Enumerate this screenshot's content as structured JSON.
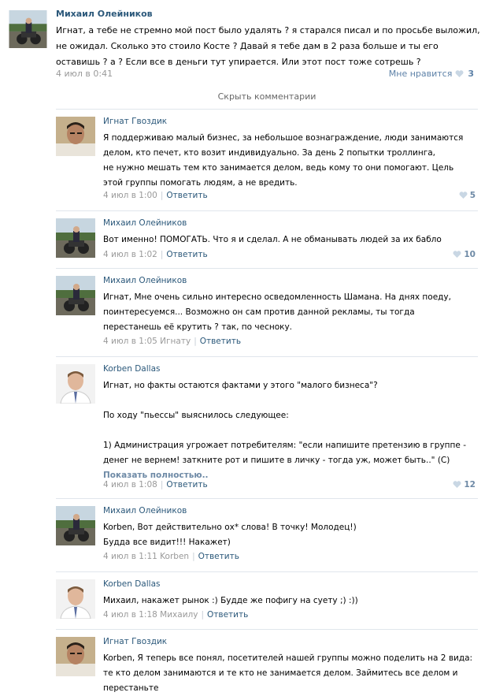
{
  "post": {
    "author": "Михаил Олейников",
    "text": "Игнат, а тебе не стремно мой пост было удалять ? я старался писал и по просьбе выложил, не ожидал. Сколько это стоило Косте ? Давай я тебе дам в 2 раза больше и ты его оставишь ? а ? Если все в деньги тут упирается. Или этот пост тоже сотрешь ?",
    "date": "4 июл в 0:41",
    "like_label": "Мне нравится",
    "like_count": "3"
  },
  "hide_comments": "Скрыть комментарии",
  "comments": [
    {
      "author": "Игнат Гвоздик",
      "text": "Я поддерживаю малый бизнес, за небольшое вознаграждение, люди занимаются делом, кто печет, кто возит индивидуально. За день 2 попытки троллинга,\nне нужно мешать тем кто занимается делом, ведь кому то они помогают. Цель этой группы помогать людям, а не вредить.",
      "date": "4 июл в 1:00",
      "reply": "Ответить",
      "likes": "5"
    },
    {
      "author": "Михаил Олейников",
      "text": "Вот именно! ПОМОГАТЬ. Что я и сделал. А не обманывать людей за их бабло",
      "date": "4 июл в 1:02",
      "reply": "Ответить",
      "likes": "10"
    },
    {
      "author": "Михаил Олейников",
      "text": "Игнат, Мне очень сильно интересно осведомленность Шамана. На днях поеду, поинтересуемся... Возможно он сам против данной рекламы, ты тогда перестанешь её крутить ? так, по чесноку.",
      "date": "4 июл в 1:05 Игнату",
      "reply": "Ответить",
      "likes": ""
    },
    {
      "author": "Korben Dallas",
      "text": "Игнат, но факты остаются фактами у этого \"малого бизнеса\"?\n\nПо ходу \"пьессы\" выяснилось следующее:\n\n1) Администрация угрожает потребителям: \"если напишите претензию в группе - денег не вернем! заткните рот и пишите в личку - тогда уж, может быть..\" (С)",
      "show_more": "Показать полностью..",
      "date": "4 июл в 1:08",
      "reply": "Ответить",
      "likes": "12"
    },
    {
      "author": "Михаил Олейников",
      "text": "Korben, Вот действительно ох* слова! В точку! Молодец!)\nБудда все видит!!! Накажет)",
      "date": "4 июл в 1:11 Korben",
      "reply": "Ответить",
      "likes": ""
    },
    {
      "author": "Korben Dallas",
      "text": "Михаил, накажет рынок :) Будде же пофигу на суету ;) :))",
      "date": "4 июл в 1:18 Михаилу",
      "reply": "Ответить",
      "likes": ""
    },
    {
      "author": "Игнат Гвоздик",
      "text": "Korben, Я теперь все понял, посетителей нашей группы можно поделить на 2 вида: те кто делом занимаются и те кто не занимается делом. Займитесь все делом и перестаньте",
      "date": "",
      "reply": "",
      "likes": ""
    }
  ]
}
